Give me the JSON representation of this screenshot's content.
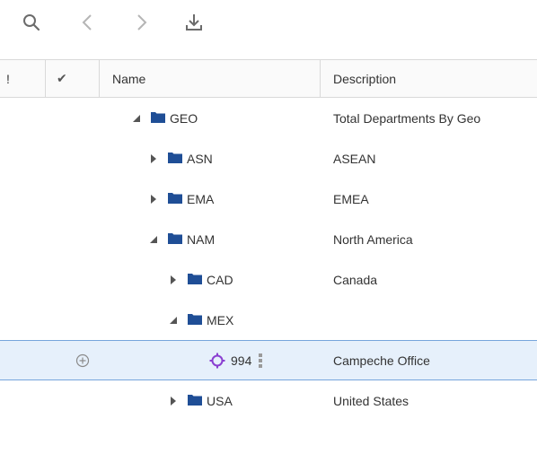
{
  "header": {
    "col_flag": "!",
    "col_check": "✔",
    "col_name": "Name",
    "col_description": "Description"
  },
  "rows": [
    {
      "name": "GEO",
      "description": "Total Departments By Geo",
      "expanded": true
    },
    {
      "name": "ASN",
      "description": "ASEAN",
      "expanded": false
    },
    {
      "name": "EMA",
      "description": "EMEA",
      "expanded": false
    },
    {
      "name": "NAM",
      "description": "North America",
      "expanded": true
    },
    {
      "name": "CAD",
      "description": "Canada",
      "expanded": false
    },
    {
      "name": "MEX",
      "description": "",
      "expanded": true
    },
    {
      "name": "994",
      "description": "Campeche Office",
      "selected": true,
      "member_type": "leaf"
    },
    {
      "name": "USA",
      "description": "United States",
      "expanded": false
    }
  ],
  "colors": {
    "folder": "#1f4e96",
    "leaf_icon": "#8a3fd1",
    "selection_bg": "#e6f0fb",
    "selection_border": "#76a5dc",
    "icon_gray": "#6b6b6b"
  }
}
